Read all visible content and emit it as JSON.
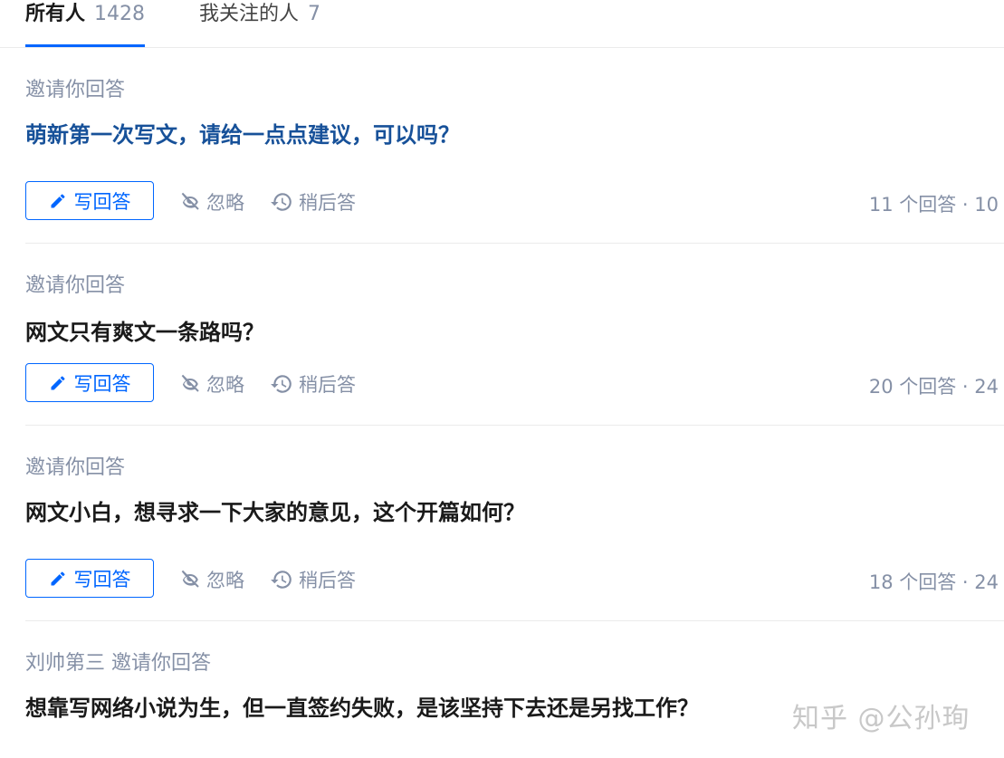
{
  "tabs": [
    {
      "label": "所有人",
      "count": "1428"
    },
    {
      "label": "我关注的人",
      "count": "7"
    }
  ],
  "questions": [
    {
      "inviter": "邀请你回答",
      "title": "萌新第一次写文，请给一点点建议，可以吗？",
      "answer_label": "写回答",
      "ignore_label": "忽略",
      "later_label": "稍后答",
      "meta": "11 个回答 · 10"
    },
    {
      "inviter": "邀请你回答",
      "title": "网文只有爽文一条路吗？",
      "answer_label": "写回答",
      "ignore_label": "忽略",
      "later_label": "稍后答",
      "meta": "20 个回答 · 24"
    },
    {
      "inviter": "邀请你回答",
      "title": "网文小白，想寻求一下大家的意见，这个开篇如何？",
      "answer_label": "写回答",
      "ignore_label": "忽略",
      "later_label": "稍后答",
      "meta": "18 个回答 · 24"
    },
    {
      "inviter": "刘帅第三 邀请你回答",
      "title": "想靠写网络小说为生，但一直签约失败，是该坚持下去还是另找工作？"
    }
  ],
  "watermark": "知乎 @公孙珣",
  "colors": {
    "accent": "#0066ff",
    "muted": "#8590a6",
    "link_title": "#175199"
  }
}
